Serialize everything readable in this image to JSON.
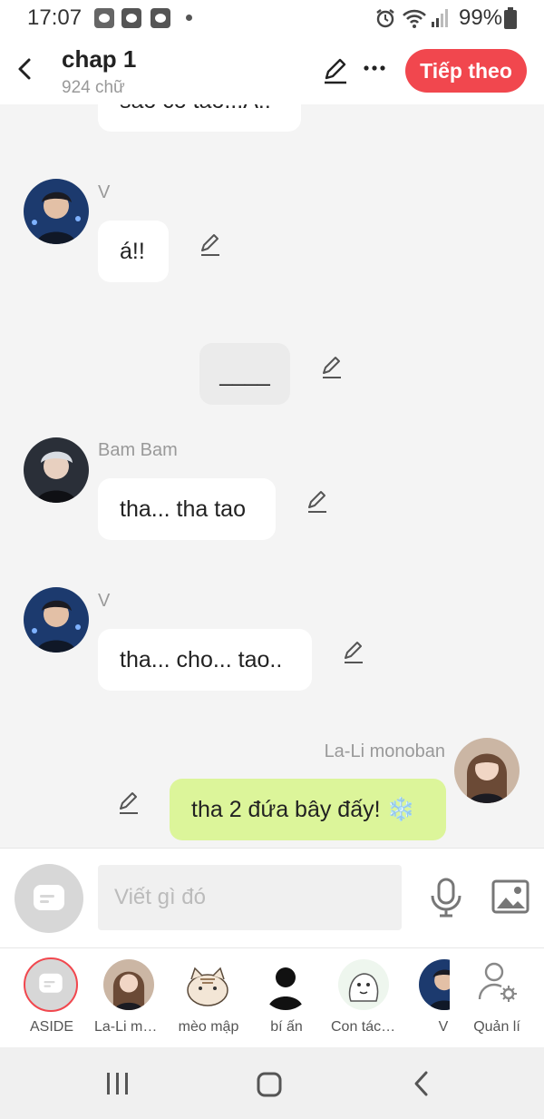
{
  "status_bar": {
    "time": "17:07",
    "battery": "99%"
  },
  "header": {
    "title": "chap 1",
    "word_count": "924 chữ",
    "next_label": "Tiếp theo"
  },
  "messages": {
    "partial_text": "sao co tao...A!!",
    "m1": {
      "sender": "V",
      "text": "á!!"
    },
    "m2": {
      "text": "____"
    },
    "m3": {
      "sender": "Bam Bam",
      "text": "tha... tha tao"
    },
    "m4": {
      "sender": "V",
      "text": "tha... cho... tao.."
    },
    "m5": {
      "sender": "La-Li monoban",
      "text": "tha 2 đứa bây đấy! ❄️"
    }
  },
  "composer": {
    "placeholder": "Viết gì đó"
  },
  "characters": {
    "c0": {
      "label": "ASIDE"
    },
    "c1": {
      "label": "La-Li monoban"
    },
    "c2": {
      "label": "mèo mập"
    },
    "c3": {
      "label": "bí ấn"
    },
    "c4": {
      "label": "Con tác giả"
    },
    "c5": {
      "label": "V"
    },
    "c6": {
      "label": "Quản lí"
    }
  },
  "colors": {
    "accent": "#f1474e",
    "own_bubble": "#dcf59a",
    "other_bubble": "#ffffff",
    "background": "#f4f4f4"
  }
}
